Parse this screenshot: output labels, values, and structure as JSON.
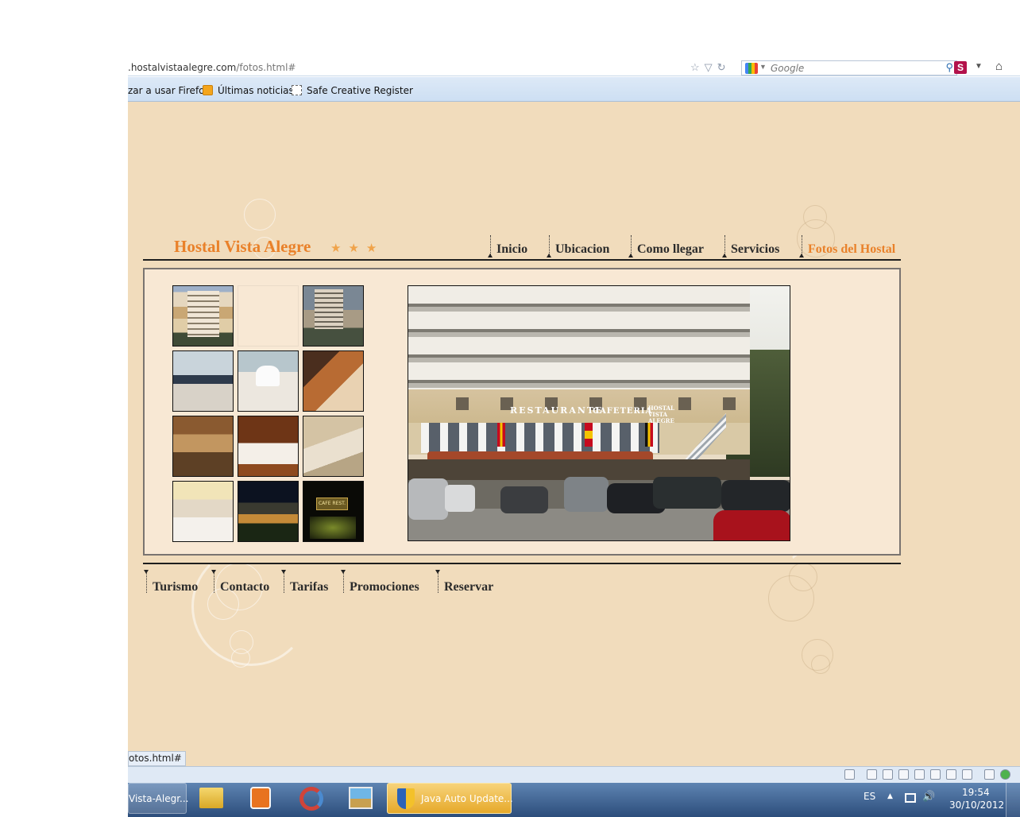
{
  "browser": {
    "url_host": ".hostalvistaalegre.com",
    "url_path": "/fotos.html#",
    "search_placeholder": "Google",
    "bookmarks": [
      "zar a usar Firefox",
      "Últimas noticias",
      "Safe Creative Register"
    ],
    "status_text": "otos.html#"
  },
  "site": {
    "title": "Hostal Vista Alegre",
    "stars": "★★★",
    "nav": [
      "Inicio",
      "Ubicacion",
      "Como llegar",
      "Servicios",
      "Fotos del Hostal"
    ],
    "active_nav": "Fotos del Hostal",
    "footer_nav": [
      "Turismo",
      "Contacto",
      "Tarifas",
      "Promociones",
      "Reservar"
    ],
    "photo_signs": {
      "restaurant": "RESTAURANTE",
      "cafe": "CAFETERIA",
      "hostal": "HOSTAL VISTA ALEGRE",
      "night_sign": "CAFE REST."
    }
  },
  "taskbar": {
    "items": [
      "Vista-Alegr...",
      "Java Auto Update..."
    ],
    "language": "ES",
    "time": "19:54",
    "date": "30/10/2012"
  },
  "colors": {
    "accent": "#e9812a",
    "page_bg": "#f1dcbc",
    "panel_bg": "#f8e8d4",
    "text": "#2b2b2b"
  }
}
